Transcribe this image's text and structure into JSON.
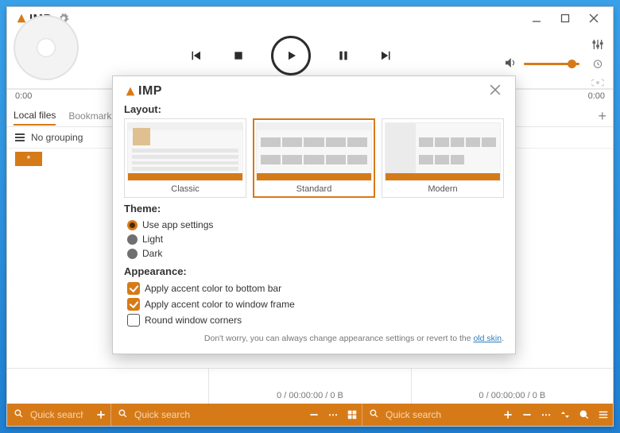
{
  "app": {
    "name": "AIMP",
    "name_suffix": "IMP"
  },
  "colors": {
    "accent": "#d67a18"
  },
  "window": {
    "controls": {
      "min": "minimize",
      "max": "maximize",
      "close": "close"
    }
  },
  "player": {
    "time_elapsed": "0:00",
    "time_total": "0:00"
  },
  "tabs": {
    "items": [
      {
        "label": "Local files",
        "active": true
      },
      {
        "label": "Bookmark"
      }
    ]
  },
  "grouping": {
    "label": "No grouping",
    "chip": "*"
  },
  "status": {
    "left": "0 / 00:00:00 / 0 B",
    "right": "0 / 00:00:00 / 0 B"
  },
  "bottom": {
    "search_placeholder": "Quick search"
  },
  "dialog": {
    "title_suffix": "IMP",
    "sections": {
      "layout": "Layout:",
      "theme": "Theme:",
      "appearance": "Appearance:"
    },
    "layouts": [
      {
        "name": "Classic",
        "selected": false
      },
      {
        "name": "Standard",
        "selected": true
      },
      {
        "name": "Modern",
        "selected": false
      }
    ],
    "themes": [
      {
        "label": "Use app settings",
        "selected": true
      },
      {
        "label": "Light",
        "selected": false
      },
      {
        "label": "Dark",
        "selected": false
      }
    ],
    "appearance": [
      {
        "label": "Apply accent color to bottom bar",
        "checked": true
      },
      {
        "label": "Apply accent color to window frame",
        "checked": true
      },
      {
        "label": "Round window corners",
        "checked": false
      }
    ],
    "footer_text": "Don't worry, you can always change appearance settings or revert to the ",
    "footer_link": "old skin",
    "footer_end": "."
  }
}
